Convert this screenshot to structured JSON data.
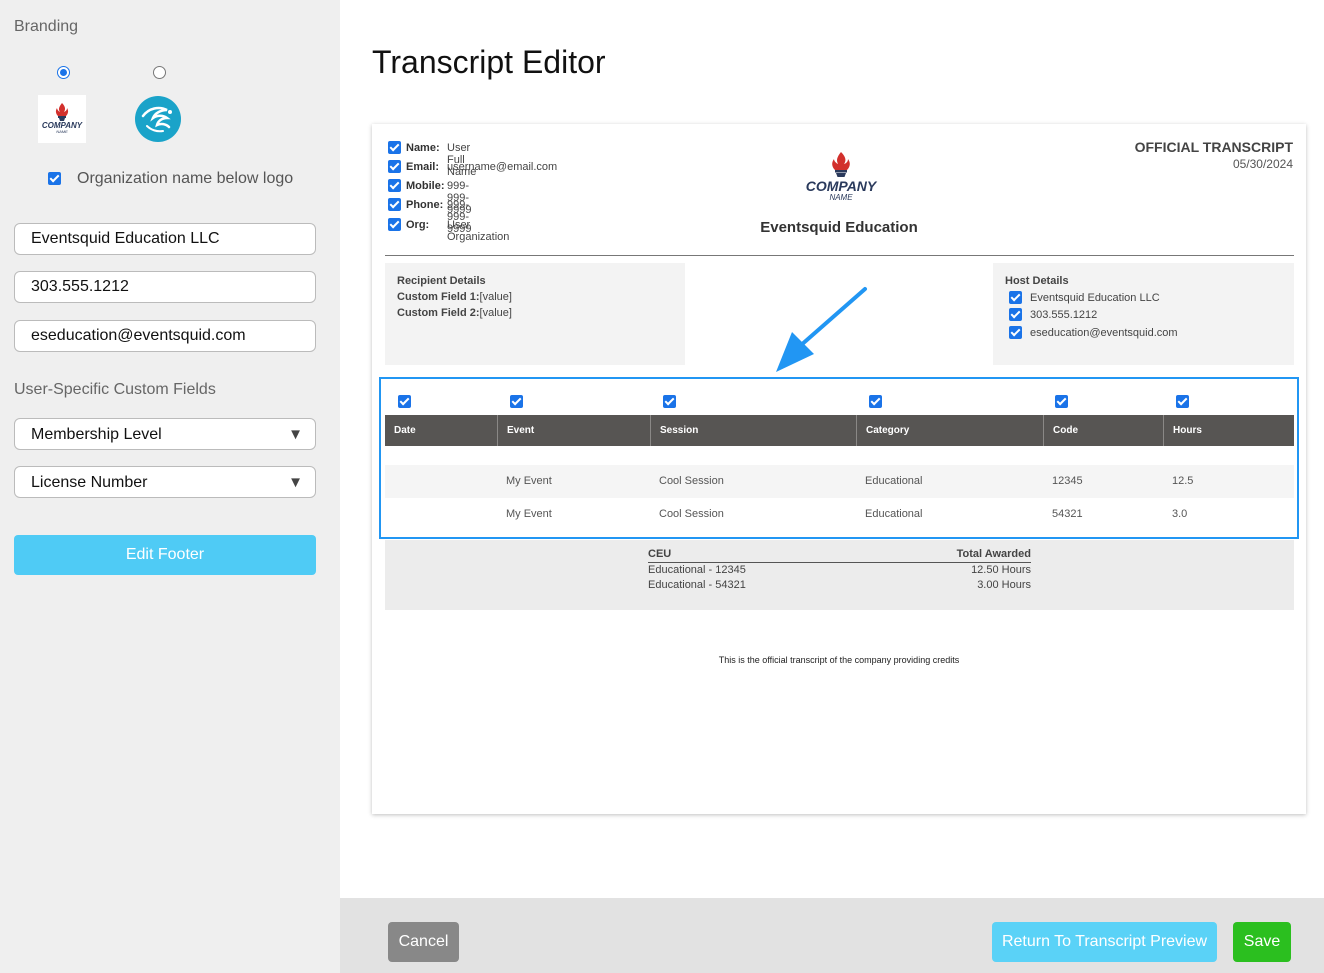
{
  "sidebar": {
    "branding_heading": "Branding",
    "org_name_below_logo_label": "Organization name below logo",
    "company_name_input": "Eventsquid Education LLC",
    "phone_input": "303.555.1212",
    "email_input": "eseducation@eventsquid.com",
    "custom_fields_heading": "User-Specific Custom Fields",
    "custom_field_1": "Membership Level",
    "custom_field_2": "License Number",
    "edit_footer_label": "Edit Footer"
  },
  "main": {
    "title": "Transcript Editor"
  },
  "doc": {
    "logo_text": "COMPANY",
    "logo_subtext": "NAME",
    "fields": [
      {
        "label": "Name:",
        "value": "User Full Name"
      },
      {
        "label": "Email:",
        "value": "username@email.com"
      },
      {
        "label": "Mobile:",
        "value": "999-999-9999"
      },
      {
        "label": "Phone:",
        "value": "999-999-9999"
      },
      {
        "label": "Org:",
        "value": "User Organization"
      }
    ],
    "org_title": "Eventsquid Education",
    "official_title": "OFFICIAL TRANSCRIPT",
    "date": "05/30/2024",
    "recipient": {
      "heading": "Recipient Details",
      "cf1_label": "Custom Field 1:",
      "cf1_value": "[value]",
      "cf2_label": "Custom Field 2:",
      "cf2_value": "[value]"
    },
    "host": {
      "heading": "Host Details",
      "items": [
        "Eventsquid Education LLC",
        "303.555.1212",
        "eseducation@eventsquid.com"
      ]
    },
    "table": {
      "headers": [
        "Date",
        "Event",
        "Session",
        "Category",
        "Code",
        "Hours"
      ],
      "rows": [
        [
          "",
          "My Event",
          "Cool Session",
          "Educational",
          "12345",
          "12.5"
        ],
        [
          "",
          "My Event",
          "Cool Session",
          "Educational",
          "54321",
          "3.0"
        ]
      ]
    },
    "ceu": {
      "heading": "CEU",
      "total_heading": "Total Awarded",
      "rows": [
        {
          "name": "Educational - 12345",
          "total": "12.50 Hours"
        },
        {
          "name": "Educational - 54321",
          "total": "3.00 Hours"
        }
      ]
    },
    "footer_text": "This is the official transcript of the company providing credits"
  },
  "actions": {
    "cancel": "Cancel",
    "return": "Return To Transcript Preview",
    "save": "Save"
  },
  "colors": {
    "accent": "#1a73e8",
    "highlight": "#2196f3",
    "save": "#2bbf1f",
    "return": "#5ad2f7",
    "table_header": "#575553"
  }
}
